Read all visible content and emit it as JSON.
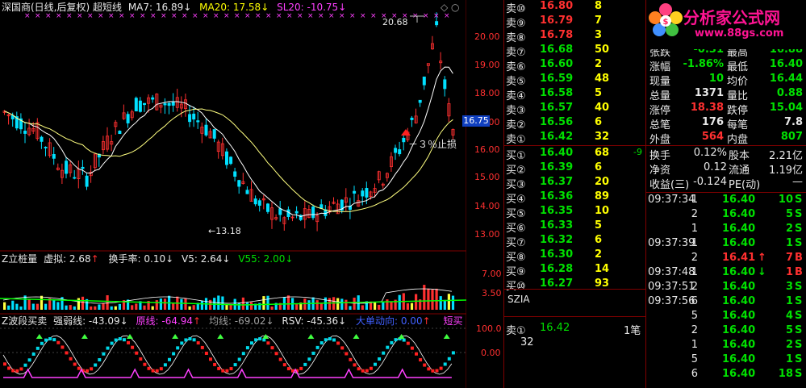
{
  "main_header": {
    "title": "深国商(日线,后复权) 超短线",
    "ma7": "MA7: 16.89",
    "ma7_arrow": "↓",
    "ma20": "MA20: 17.58",
    "ma20_arrow": "↓",
    "sl20": "SL20: -10.75",
    "sl20_arrow": "↓"
  },
  "price_axis": [
    "20.00",
    "19.00",
    "18.00",
    "17.00",
    "16.00",
    "15.00",
    "14.00",
    "13.00"
  ],
  "current_price_tag": "16.75",
  "annotations": {
    "high": "20.68",
    "low": "←13.18",
    "stop_loss": "－３％止损"
  },
  "vol_header": {
    "title": "Z立桩量",
    "virtual": "虚拟: 2.68",
    "virtual_arrow": "↑",
    "turnover": "换手率: 0.10",
    "turnover_arrow": "↓",
    "v5": "V5: 2.64",
    "v5_arrow": "↓",
    "v55": "V55: 2.00",
    "v55_arrow": "↓"
  },
  "vol_axis": [
    "7.00",
    "3.50"
  ],
  "ind_header": {
    "title": "Z波段买卖",
    "strength": "强弱线: -43.09",
    "strength_arrow": "↓",
    "base": "原线: -64.94",
    "base_arrow": "↑",
    "avg": "均线: -69.02",
    "avg_arrow": "↓",
    "rsv": "RSV: -45.36",
    "rsv_arrow": "↓",
    "bigorder": "大单动向: 0.00",
    "bigorder_arrow": "↑",
    "short_buy": "短买"
  },
  "ind_axis": [
    "100.0",
    "0.00"
  ],
  "sell_orders": [
    {
      "label": "卖⑩",
      "price": "16.80",
      "vol": "8",
      "color": "red"
    },
    {
      "label": "卖⑨",
      "price": "16.79",
      "vol": "7",
      "color": "red"
    },
    {
      "label": "卖⑧",
      "price": "16.78",
      "vol": "3",
      "color": "red"
    },
    {
      "label": "卖⑦",
      "price": "16.68",
      "vol": "50",
      "color": "green"
    },
    {
      "label": "卖⑥",
      "price": "16.60",
      "vol": "2",
      "color": "green"
    },
    {
      "label": "卖⑤",
      "price": "16.59",
      "vol": "48",
      "color": "green"
    },
    {
      "label": "卖④",
      "price": "16.58",
      "vol": "5",
      "color": "green"
    },
    {
      "label": "卖③",
      "price": "16.57",
      "vol": "40",
      "color": "green"
    },
    {
      "label": "卖②",
      "price": "16.56",
      "vol": "6",
      "color": "green"
    },
    {
      "label": "卖①",
      "price": "16.42",
      "vol": "32",
      "color": "green"
    }
  ],
  "buy_orders": [
    {
      "label": "买①",
      "price": "16.40",
      "vol": "68",
      "extra": "-9",
      "color": "green"
    },
    {
      "label": "买②",
      "price": "16.39",
      "vol": "6",
      "extra": "",
      "color": "green"
    },
    {
      "label": "买③",
      "price": "16.37",
      "vol": "20",
      "extra": "",
      "color": "green"
    },
    {
      "label": "买④",
      "price": "16.36",
      "vol": "89",
      "extra": "",
      "color": "green"
    },
    {
      "label": "买⑤",
      "price": "16.35",
      "vol": "10",
      "extra": "",
      "color": "green"
    },
    {
      "label": "买⑥",
      "price": "16.33",
      "vol": "5",
      "extra": "",
      "color": "green"
    },
    {
      "label": "买⑦",
      "price": "16.32",
      "vol": "6",
      "extra": "",
      "color": "green"
    },
    {
      "label": "买⑧",
      "price": "16.30",
      "vol": "2",
      "extra": "",
      "color": "green"
    },
    {
      "label": "买⑨",
      "price": "16.28",
      "vol": "14",
      "extra": "",
      "color": "green"
    },
    {
      "label": "买⑩",
      "price": "16.27",
      "vol": "93",
      "extra": "",
      "color": "green"
    }
  ],
  "order_book_footer": {
    "szia": "SZIA",
    "sell1_label": "卖①",
    "sell1_price": "16.42",
    "sell1_count": "1笔",
    "sell1_qty": "32"
  },
  "logo": {
    "text": "分析家公式网",
    "url": "www.88gs.com"
  },
  "quote_rows": [
    {
      "l1": "张跌",
      "v1": "-0.31",
      "l2": "最高",
      "v2": "16.88",
      "c1": "green",
      "c2": "green",
      "partial": true
    },
    {
      "l1": "涨幅",
      "v1": "-1.86%",
      "l2": "最低",
      "v2": "16.40",
      "c1": "green",
      "c2": "green"
    },
    {
      "l1": "现量",
      "v1": "10",
      "l2": "均价",
      "v2": "16.44",
      "c1": "green",
      "c2": "green"
    },
    {
      "l1": "总量",
      "v1": "1371",
      "l2": "量比",
      "v2": "0.88",
      "c1": "white",
      "c2": "green"
    },
    {
      "l1": "涨停",
      "v1": "18.38",
      "l2": "跌停",
      "v2": "15.04",
      "c1": "red",
      "c2": "green"
    },
    {
      "l1": "总笔",
      "v1": "176",
      "l2": "每笔",
      "v2": "7.8",
      "c1": "white",
      "c2": "white"
    },
    {
      "l1": "外盘",
      "v1": "564",
      "l2": "内盘",
      "v2": "807",
      "c1": "red",
      "c2": "green"
    }
  ],
  "stats_rows": [
    {
      "l1": "换手",
      "v1": "0.12%",
      "l2": "股本",
      "v2": "2.21亿"
    },
    {
      "l1": "净资",
      "v1": "0.12",
      "l2": "流通",
      "v2": "1.19亿"
    },
    {
      "l1": "收益(三)",
      "v1": "-0.124",
      "l2": "PE(动)",
      "v2": "—"
    }
  ],
  "ticks": [
    {
      "time": "09:37:34",
      "n": "1",
      "price": "16.40",
      "arrow": "",
      "vol": "10",
      "side": "S"
    },
    {
      "time": "",
      "n": "2",
      "price": "16.40",
      "arrow": "",
      "vol": "5",
      "side": "S"
    },
    {
      "time": "",
      "n": "1",
      "price": "16.40",
      "arrow": "",
      "vol": "2",
      "side": "S"
    },
    {
      "time": "09:37:39",
      "n": "1",
      "price": "16.40",
      "arrow": "",
      "vol": "1",
      "side": "S"
    },
    {
      "time": "",
      "n": "2",
      "price": "16.41",
      "arrow": "↑",
      "vol": "7",
      "side": "B"
    },
    {
      "time": "09:37:48",
      "n": "1",
      "price": "16.40",
      "arrow": "↓",
      "vol": "1",
      "side": "B"
    },
    {
      "time": "09:37:51",
      "n": "2",
      "price": "16.40",
      "arrow": "",
      "vol": "3",
      "side": "S"
    },
    {
      "time": "09:37:56",
      "n": "6",
      "price": "16.40",
      "arrow": "",
      "vol": "1",
      "side": "S"
    },
    {
      "time": "",
      "n": "5",
      "price": "16.40",
      "arrow": "",
      "vol": "4",
      "side": "S"
    },
    {
      "time": "",
      "n": "2",
      "price": "16.40",
      "arrow": "",
      "vol": "5",
      "side": "S"
    },
    {
      "time": "",
      "n": "1",
      "price": "16.40",
      "arrow": "",
      "vol": "2",
      "side": "S"
    },
    {
      "time": "",
      "n": "5",
      "price": "16.40",
      "arrow": "",
      "vol": "1",
      "side": "S"
    },
    {
      "time": "",
      "n": "6",
      "price": "16.40",
      "arrow": "",
      "vol": "18",
      "side": "S"
    }
  ],
  "colors": {
    "up": "#ff3030",
    "down": "#00e0ff",
    "grid": "#800000",
    "ma7": "#ffffff",
    "ma20": "#ffff80",
    "label_purple": "#ff40ff"
  }
}
